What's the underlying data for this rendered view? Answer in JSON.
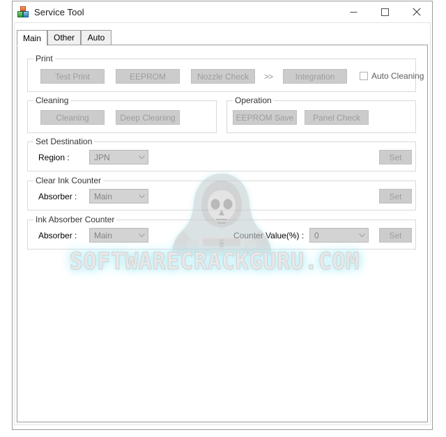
{
  "window": {
    "title": "Service Tool",
    "icon": "app-blocks-icon",
    "controls": {
      "minimize": "minimize-icon",
      "maximize": "maximize-icon",
      "close": "close-icon"
    }
  },
  "tabs": [
    {
      "label": "Main",
      "selected": true
    },
    {
      "label": "Other",
      "selected": false
    },
    {
      "label": "Auto",
      "selected": false
    }
  ],
  "groups": {
    "print": {
      "title": "Print",
      "buttons": [
        {
          "label": "Test Print",
          "enabled": false
        },
        {
          "label": "EEPROM",
          "enabled": false
        },
        {
          "label": "Nozzle Check",
          "enabled": false
        },
        {
          "label": "Integration",
          "enabled": false
        }
      ],
      "separator": ">>",
      "checkbox": {
        "label": "Auto Cleaning",
        "checked": false
      }
    },
    "cleaning": {
      "title": "Cleaning",
      "buttons": [
        {
          "label": "Cleaning",
          "enabled": false
        },
        {
          "label": "Deep Cleaning",
          "enabled": false
        }
      ]
    },
    "operation": {
      "title": "Operation",
      "buttons": [
        {
          "label": "EEPROM Save",
          "enabled": false
        },
        {
          "label": "Panel Check",
          "enabled": false
        }
      ]
    },
    "set_destination": {
      "title": "Set Destination",
      "region_label": "Region :",
      "region_value": "JPN",
      "set_label": "Set"
    },
    "clear_ink_counter": {
      "title": "Clear Ink Counter",
      "absorber_label": "Absorber :",
      "absorber_value": "Main",
      "set_label": "Set"
    },
    "ink_absorber_counter": {
      "title": "Ink Absorber Counter",
      "absorber_label": "Absorber :",
      "absorber_value": "Main",
      "counter_label": "Counter Value(%) :",
      "counter_value": "0",
      "set_label": "Set"
    }
  },
  "watermark": {
    "text": "SOFTWARECRACKGURU.COM",
    "figure": "hooded-skeleton-hacker-icon",
    "glow_color": "#bfeef7"
  },
  "colors": {
    "window_border": "#9b9b9b",
    "group_border": "#d9d9d9",
    "disabled_button_bg": "#cccccc",
    "disabled_button_text": "#9d9d9d",
    "combo_bg": "#d3d3d3",
    "combo_text": "#838383",
    "body_bg": "#ffffff"
  }
}
